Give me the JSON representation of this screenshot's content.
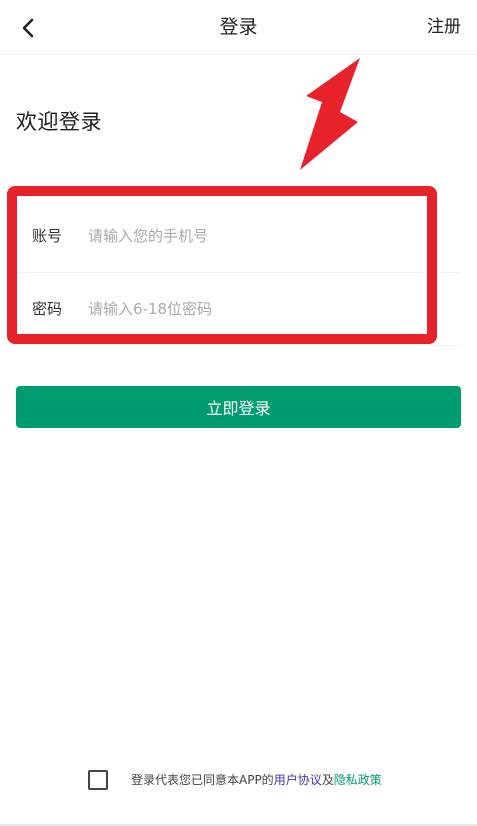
{
  "header": {
    "title": "登录",
    "register_label": "注册"
  },
  "welcome": "欢迎登录",
  "form": {
    "account_label": "账号",
    "account_placeholder": "请输入您的手机号",
    "password_label": "密码",
    "password_placeholder": "请输入6-18位密码"
  },
  "login_button": "立即登录",
  "agreement": {
    "prefix": "登录代表您已同意本APP的",
    "user_agreement": "用户协议",
    "connector": "及",
    "privacy_policy": "隐私政策",
    "checked": false
  },
  "colors": {
    "primary": "#009c6f",
    "annotation": "#e8222a",
    "link_user_agreement": "#4a2fb3"
  }
}
